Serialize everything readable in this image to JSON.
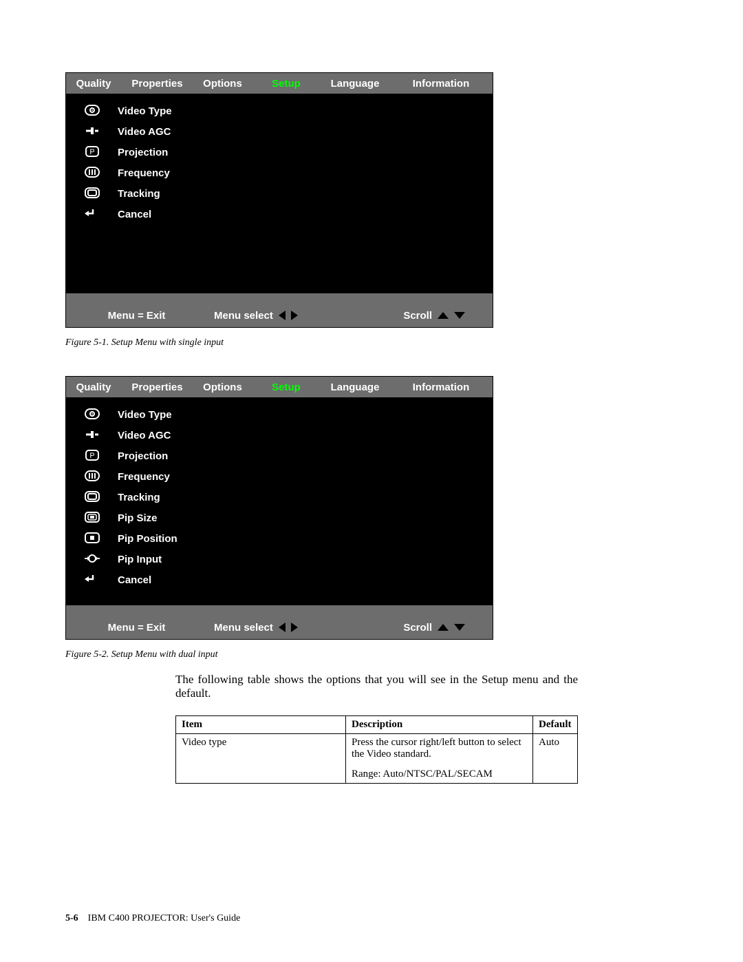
{
  "osd": {
    "tabs": [
      "Quality",
      "Properties",
      "Options",
      "Setup",
      "Language",
      "Information"
    ],
    "active_tab": "Setup",
    "menu1_items": [
      {
        "icon": "target",
        "label": "Video Type"
      },
      {
        "icon": "slider",
        "label": "Video AGC"
      },
      {
        "icon": "pbox",
        "label": "Projection"
      },
      {
        "icon": "bars",
        "label": "Frequency"
      },
      {
        "icon": "screen",
        "label": "Tracking"
      },
      {
        "icon": "return",
        "label": "Cancel"
      }
    ],
    "menu2_items": [
      {
        "icon": "target",
        "label": "Video Type"
      },
      {
        "icon": "slider",
        "label": "Video AGC"
      },
      {
        "icon": "pbox",
        "label": "Projection"
      },
      {
        "icon": "bars",
        "label": "Frequency"
      },
      {
        "icon": "screen",
        "label": "Tracking"
      },
      {
        "icon": "pipsize",
        "label": "Pip Size"
      },
      {
        "icon": "pippos",
        "label": "Pip Position"
      },
      {
        "icon": "pipinput",
        "label": "Pip Input"
      },
      {
        "icon": "return",
        "label": "Cancel"
      }
    ],
    "footer": {
      "exit": "Menu = Exit",
      "select": "Menu select",
      "scroll": "Scroll"
    }
  },
  "captions": {
    "fig1": "Figure 5-1. Setup Menu with single input",
    "fig2": "Figure 5-2. Setup Menu with dual input"
  },
  "body_text": "The following table shows the options that you will see in the Setup menu and the default.",
  "table": {
    "headers": [
      "Item",
      "Description",
      "Default"
    ],
    "row": {
      "item": "Video type",
      "desc_line1": "Press the cursor right/left button to select the Video standard.",
      "desc_line2": "Range: Auto/NTSC/PAL/SECAM",
      "default": "Auto"
    }
  },
  "footer": {
    "page": "5-6",
    "title": "IBM C400 PROJECTOR: User's Guide"
  }
}
